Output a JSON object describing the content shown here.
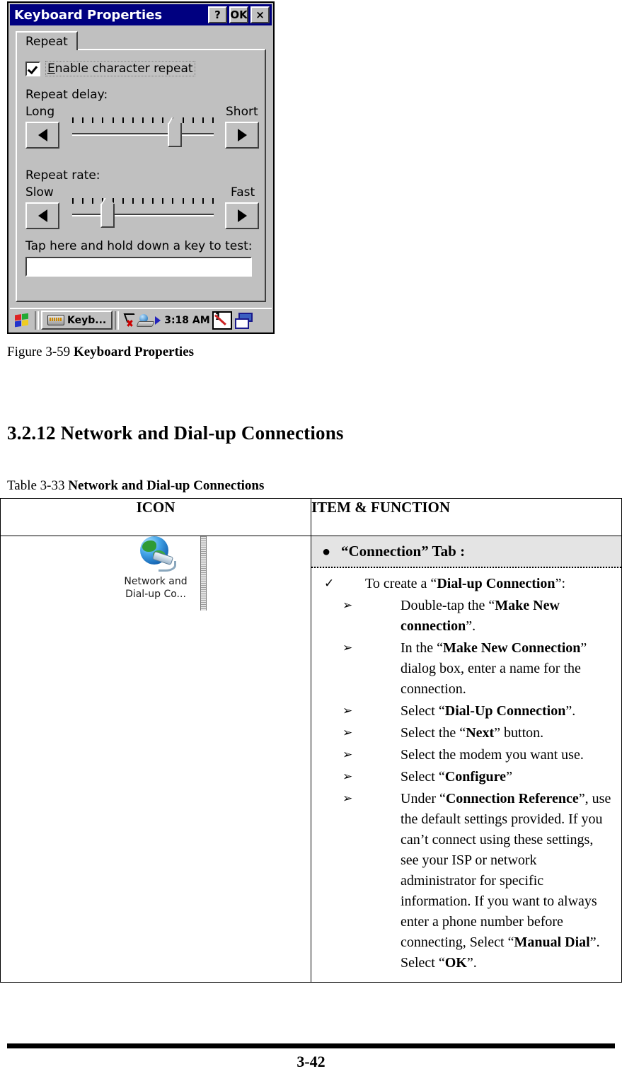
{
  "dialog": {
    "title": "Keyboard Properties",
    "title_buttons": [
      {
        "name": "help-button",
        "label": "?"
      },
      {
        "name": "ok-button",
        "label": "OK"
      },
      {
        "name": "close-button",
        "label": "×"
      }
    ],
    "tab": "Repeat",
    "checkbox": {
      "label_pre": "E",
      "label_rest": "nable character repeat",
      "checked": true
    },
    "repeat_delay": {
      "title": "Repeat delay:",
      "left_label": "Long",
      "right_label": "Short",
      "value_percent": 75,
      "tick_count": 15
    },
    "repeat_rate": {
      "title": "Repeat rate:",
      "left_label": "Slow",
      "right_label": "Fast",
      "value_percent": 22,
      "tick_count": 15
    },
    "test_label": "Tap here and hold down a key to test:",
    "test_input_value": "",
    "taskbar": {
      "start_icon": "windows-flag-icon",
      "task_button": "Keyb...",
      "clock": "3:18 AM",
      "tray_icons": [
        "network-disconnected-icon",
        "network-pc-icon",
        "play-icon",
        "input-panel-icon",
        "desktop-icon"
      ]
    },
    "colors": {
      "titlebar": "#000080",
      "face": "#c0c0c0",
      "shadow": "#404040",
      "highlight": "#ffffff"
    }
  },
  "figure_caption": {
    "prefix": "Figure 3-59 ",
    "bold": "Keyboard Properties"
  },
  "section_heading": "3.2.12 Network and Dial-up Connections",
  "table_caption": {
    "prefix": "Table 3-33 ",
    "bold": "Network and Dial-up Connections"
  },
  "table": {
    "headers": {
      "icon": "ICON",
      "item": "ITEM & FUNCTION"
    },
    "icon_cell": {
      "icon_name": "network-dialup-globe-icon",
      "label_line1": "Network and",
      "label_line2": "Dial-up Co..."
    },
    "tab_row": {
      "bullet": "●",
      "text_pre": "“",
      "text_bold": "Connection",
      "text_post": "” Tab :"
    },
    "items": [
      {
        "level": 1,
        "marker": "✓",
        "parts": [
          {
            "t": "To create a “",
            "b": false
          },
          {
            "t": "Dial-up Connection",
            "b": true
          },
          {
            "t": "”:",
            "b": false
          }
        ]
      },
      {
        "level": 2,
        "marker": "➢",
        "parts": [
          {
            "t": "Double-tap the “",
            "b": false
          },
          {
            "t": "Make New connection",
            "b": true
          },
          {
            "t": "”.",
            "b": false
          }
        ]
      },
      {
        "level": 2,
        "marker": "➢",
        "parts": [
          {
            "t": "In the “",
            "b": false
          },
          {
            "t": "Make New Connection",
            "b": true
          },
          {
            "t": "” dialog box, enter a name for the connection.",
            "b": false
          }
        ]
      },
      {
        "level": 2,
        "marker": "➢",
        "parts": [
          {
            "t": "Select “",
            "b": false
          },
          {
            "t": "Dial-Up Connection",
            "b": true
          },
          {
            "t": "”.",
            "b": false
          }
        ]
      },
      {
        "level": 2,
        "marker": "➢",
        "parts": [
          {
            "t": "Select the “",
            "b": false
          },
          {
            "t": "Next",
            "b": true
          },
          {
            "t": "” button.",
            "b": false
          }
        ]
      },
      {
        "level": 2,
        "marker": "➢",
        "parts": [
          {
            "t": "Select the modem you want use.",
            "b": false
          }
        ]
      },
      {
        "level": 2,
        "marker": "➢",
        "parts": [
          {
            "t": "Select “",
            "b": false
          },
          {
            "t": "Configure",
            "b": true
          },
          {
            "t": "”",
            "b": false
          }
        ]
      },
      {
        "level": 2,
        "marker": "➢",
        "parts": [
          {
            "t": "Under “",
            "b": false
          },
          {
            "t": "Connection Reference",
            "b": true
          },
          {
            "t": "”, use the default settings provided. If you can’t connect using these settings, see your ISP or network administrator for specific information. If you want to always enter a phone number before connecting, Select “",
            "b": false
          },
          {
            "t": "Manual Dial",
            "b": true
          },
          {
            "t": "”. Select “",
            "b": false
          },
          {
            "t": "OK",
            "b": true
          },
          {
            "t": "”.",
            "b": false
          }
        ]
      }
    ]
  },
  "footer": {
    "page_number": "3-42"
  }
}
